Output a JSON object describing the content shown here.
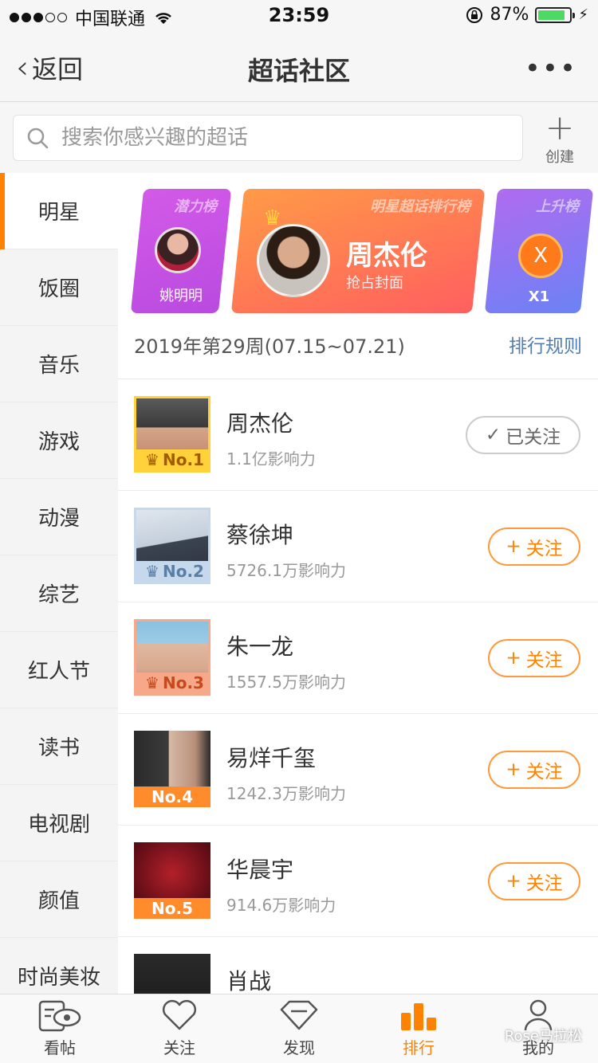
{
  "status": {
    "carrier": "中国联通",
    "time": "23:59",
    "battery": "87%",
    "battery_level": 0.87
  },
  "nav": {
    "back": "返回",
    "title": "超话社区",
    "more": "•••"
  },
  "search": {
    "placeholder": "搜索你感兴趣的超话",
    "create": "创建"
  },
  "sidebar": {
    "items": [
      {
        "label": "明星"
      },
      {
        "label": "饭圈"
      },
      {
        "label": "音乐"
      },
      {
        "label": "游戏"
      },
      {
        "label": "动漫"
      },
      {
        "label": "综艺"
      },
      {
        "label": "红人节"
      },
      {
        "label": "读书"
      },
      {
        "label": "电视剧"
      },
      {
        "label": "颜值"
      },
      {
        "label": "时尚美妆"
      }
    ]
  },
  "banners": {
    "left": {
      "tag": "潜力榜",
      "name": "姚明明"
    },
    "mid": {
      "tag": "明星超话排行榜",
      "name": "周杰伦",
      "sub": "抢占封面"
    },
    "right": {
      "tag": "上升榜",
      "badge": "X",
      "name": "X1"
    }
  },
  "ranking": {
    "week": "2019年第29周(07.15~07.21)",
    "rules": "排行规则",
    "items": [
      {
        "rank": "No.1",
        "name": "周杰伦",
        "influence": "1.1亿影响力",
        "button": "已关注"
      },
      {
        "rank": "No.2",
        "name": "蔡徐坤",
        "influence": "5726.1万影响力",
        "button": "关注"
      },
      {
        "rank": "No.3",
        "name": "朱一龙",
        "influence": "1557.5万影响力",
        "button": "关注"
      },
      {
        "rank": "No.4",
        "name": "易烊千玺",
        "influence": "1242.3万影响力",
        "button": "关注"
      },
      {
        "rank": "No.5",
        "name": "华晨宇",
        "influence": "914.6万影响力",
        "button": "关注"
      },
      {
        "rank": "",
        "name": "肖战",
        "influence": "",
        "button": ""
      }
    ]
  },
  "tabs": [
    {
      "label": "看帖"
    },
    {
      "label": "关注"
    },
    {
      "label": "发现"
    },
    {
      "label": "排行"
    },
    {
      "label": "我的"
    }
  ],
  "watermark": "Rose马拉松",
  "colors": {
    "accent": "#ff8200",
    "link": "#527eb0"
  }
}
